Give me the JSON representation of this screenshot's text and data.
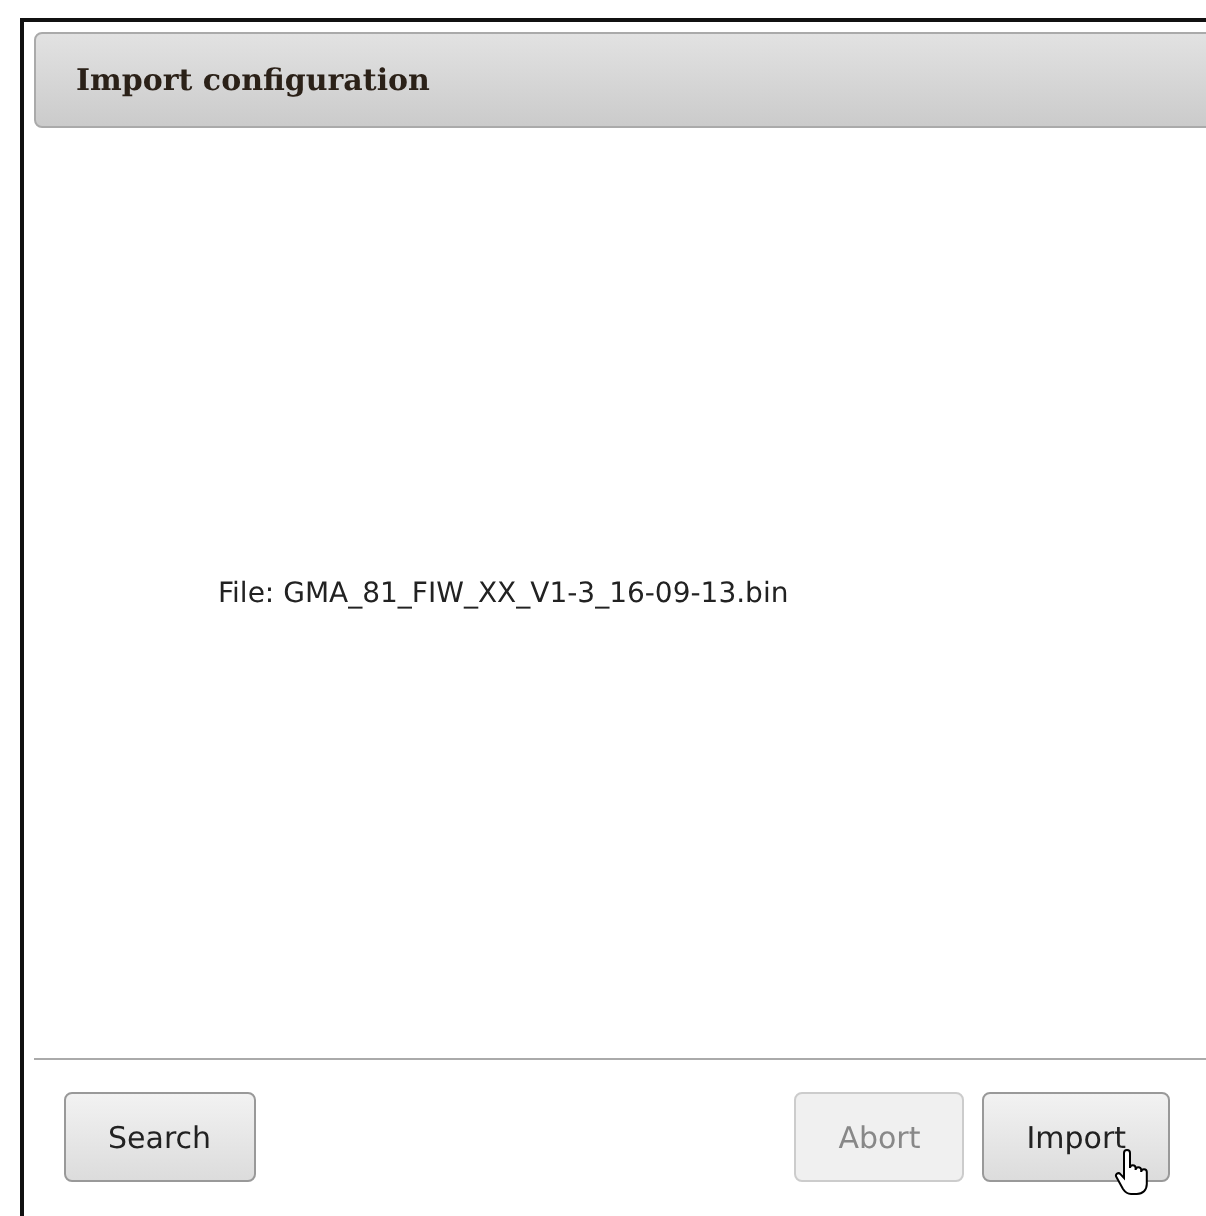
{
  "dialog": {
    "title": "Import configuration",
    "file_label": "File: GMA_81_FIW_XX_V1-3_16-09-13.bin"
  },
  "footer": {
    "left_buttons": [
      {
        "label": "Search",
        "disabled": false
      }
    ],
    "right_buttons": [
      {
        "label": "Abort",
        "disabled": true
      },
      {
        "label": "Import",
        "disabled": false
      }
    ]
  }
}
